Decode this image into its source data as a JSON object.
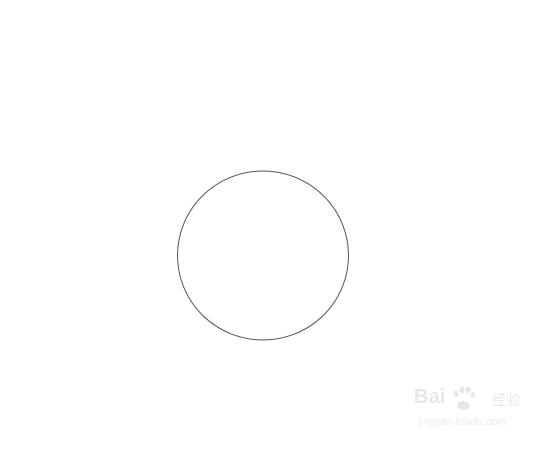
{
  "diagram": {
    "shape": "circle",
    "stroke_color": "#555555",
    "fill_color": "#ffffff"
  },
  "watermark": {
    "brand_left": "Bai",
    "brand_right": "经验",
    "url": "jingyan.baidu.com",
    "icon": "paw-icon",
    "color": "#cccccc"
  }
}
